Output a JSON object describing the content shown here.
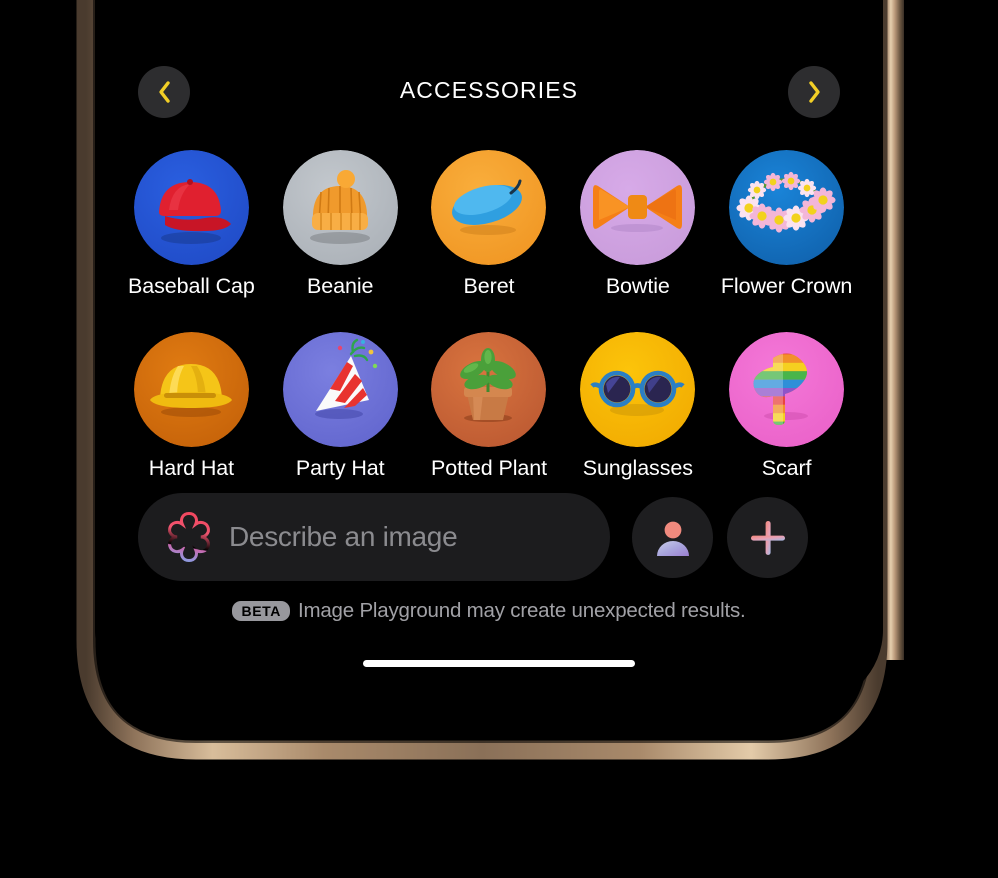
{
  "device": {
    "frame_color": "#c9a883",
    "screen_background": "#000000"
  },
  "header": {
    "title": "ACCESSORIES",
    "prev_icon": "chevron-left-icon",
    "next_icon": "chevron-right-icon",
    "chevron_color": "#f2cf26",
    "button_background": "#2d2d2f"
  },
  "grid": {
    "items": [
      {
        "label": "Baseball Cap",
        "art": "baseball-cap",
        "bg_from": "#2a5fe0",
        "bg_to": "#1f49c4",
        "accent": "#e01f35"
      },
      {
        "label": "Beanie",
        "art": "beanie",
        "bg_from": "#c3c8cd",
        "bg_to": "#a8aeb5",
        "accent": "#f08a1e"
      },
      {
        "label": "Beret",
        "art": "beret",
        "bg_from": "#f9ae3c",
        "bg_to": "#ef9320",
        "accent": "#2f9fe0"
      },
      {
        "label": "Bowtie",
        "art": "bowtie",
        "bg_from": "#d7aae8",
        "bg_to": "#c79ad9",
        "accent": "#f57f17"
      },
      {
        "label": "Flower Crown",
        "art": "flower-crown",
        "bg_from": "#1a84d8",
        "bg_to": "#0f5ea8",
        "accent": "#f0a8cf"
      },
      {
        "label": "Hard Hat",
        "art": "hard-hat",
        "bg_from": "#e07b12",
        "bg_to": "#c25f08",
        "accent": "#f5c518"
      },
      {
        "label": "Party Hat",
        "art": "party-hat",
        "bg_from": "#7b7fe0",
        "bg_to": "#5f63cc",
        "accent": "#e8332f"
      },
      {
        "label": "Potted Plant",
        "art": "potted-plant",
        "bg_from": "#d9743f",
        "bg_to": "#b85630",
        "accent": "#4aa03a"
      },
      {
        "label": "Sunglasses",
        "art": "sunglasses",
        "bg_from": "#fcc40a",
        "bg_to": "#f0a800",
        "accent": "#2b7fc4"
      },
      {
        "label": "Scarf",
        "art": "scarf",
        "bg_from": "#f478d8",
        "bg_to": "#e95fc7",
        "accent": "#9b59d0"
      }
    ]
  },
  "composer": {
    "prompt_placeholder": "Describe an image",
    "ai_icon": "apple-intelligence-icon",
    "person_icon": "person-icon",
    "add_icon": "plus-icon",
    "field_background": "#1c1c1e",
    "button_background": "#1e1e20"
  },
  "footer": {
    "badge": "BETA",
    "note": "Image Playground may create unexpected results.",
    "badge_background": "#98989d"
  }
}
